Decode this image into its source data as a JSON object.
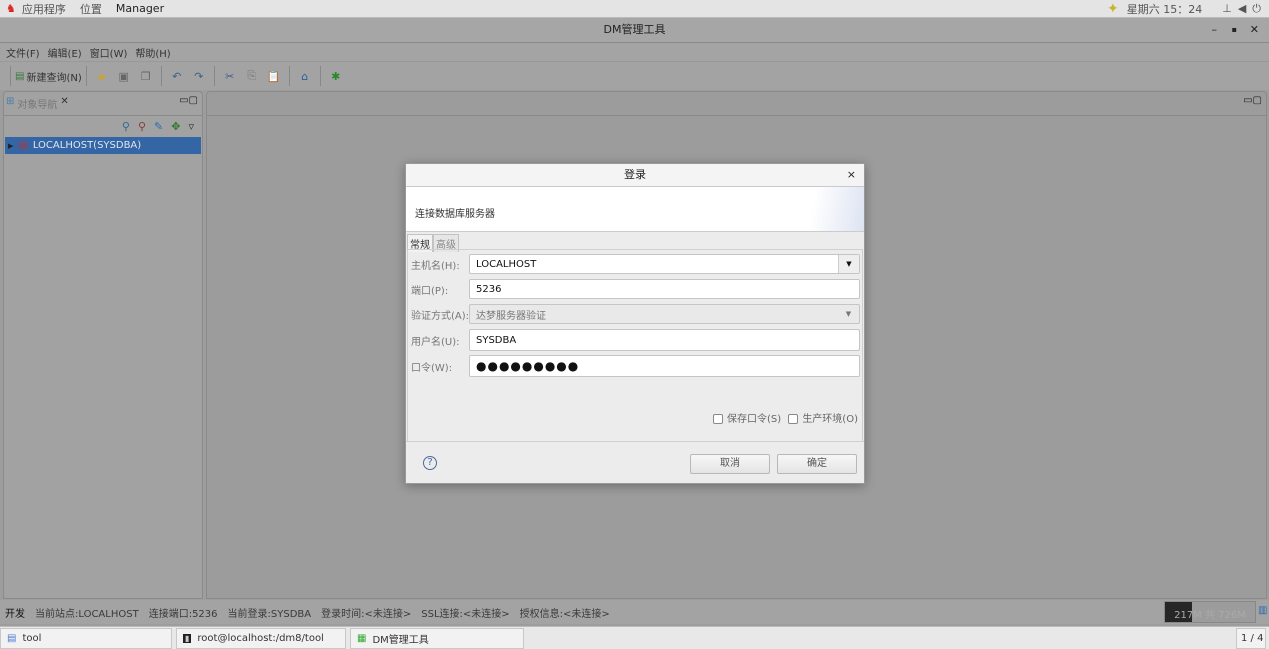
{
  "topbar": {
    "apps": "应用程序",
    "places": "位置",
    "manager": "Manager",
    "clock": "星期六 15：24"
  },
  "window": {
    "title": "DM管理工具",
    "min": "–",
    "max": "▪",
    "close": "✕"
  },
  "menu": [
    "文件(F)",
    "编辑(E)",
    "窗口(W)",
    "帮助(H)"
  ],
  "toolbar": {
    "new_query": "新建查询(N)"
  },
  "navigator": {
    "tab": "对象导航",
    "tree": [
      {
        "label": "LOCALHOST(SYSDBA)"
      }
    ]
  },
  "dialog": {
    "title": "登录",
    "close": "×",
    "header": "连接数据库服务器",
    "tabs": [
      "常规",
      "高级"
    ],
    "host_label": "主机名(H):",
    "host": "LOCALHOST",
    "port_label": "端口(P):",
    "port": "5236",
    "auth_label": "验证方式(A):",
    "auth": "达梦服务器验证",
    "user_label": "用户名(U):",
    "user": "SYSDBA",
    "pwd_label": "口令(W):",
    "pwd": "●●●●●●●●●",
    "save_pwd": "保存口令(S)",
    "prod_env": "生产环境(O)",
    "help": "?",
    "cancel": "取消",
    "ok": "确定"
  },
  "status": {
    "mode": "开发",
    "site": "当前站点:LOCALHOST",
    "port": "连接端口:5236",
    "login": "当前登录:SYSDBA",
    "login_time": "登录时间:<未连接>",
    "ssl": "SSL连接:<未连接>",
    "license": "授权信息:<未连接>",
    "memory": "217M 共 726M",
    "memory_fraction": 0.3
  },
  "taskbar": {
    "items": [
      "tool",
      "root@localhost:/dm8/tool",
      "DM管理工具"
    ],
    "workspace": "1 / 4"
  }
}
